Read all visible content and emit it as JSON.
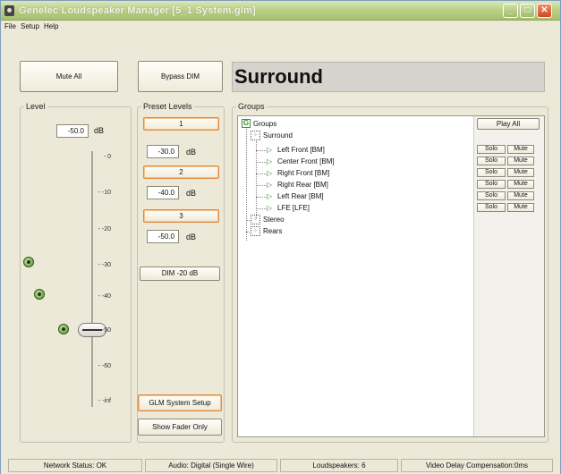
{
  "window": {
    "title": "Genelec Loudspeaker Manager [5_1 System.glm]",
    "buttons": [
      "minimize",
      "maximize",
      "close"
    ]
  },
  "menu": [
    "File",
    "Setup",
    "Help"
  ],
  "toolbar": {
    "mute_all": "Mute All",
    "bypass_dim": "Bypass DIM"
  },
  "header": {
    "title": "Surround"
  },
  "level": {
    "label": "Level",
    "value": "-50.0",
    "unit": "dB",
    "ticks": [
      "- 0",
      "- -10",
      "- -20",
      "- -30",
      "- -40",
      "- -50",
      "- -60",
      "- -inf"
    ],
    "fader_value_db": -50
  },
  "preset_levels": {
    "label": "Preset Levels",
    "presets": [
      {
        "button": "1",
        "value": "-30.0",
        "unit": "dB"
      },
      {
        "button": "2",
        "value": "-40.0",
        "unit": "dB"
      },
      {
        "button": "3",
        "value": "-50.0",
        "unit": "dB"
      }
    ],
    "dim": "DIM -20 dB"
  },
  "bottom_buttons": {
    "system_setup": "GLM System Setup",
    "fader_only": "Show Fader Only"
  },
  "groups": {
    "label": "Groups",
    "root": "Groups",
    "play_all": "Play All",
    "surround": "Surround",
    "speakers": [
      "Left Front [BM]",
      "Center Front [BM]",
      "Right Front [BM]",
      "Right Rear [BM]",
      "Left Rear [BM]",
      "LFE [LFE]"
    ],
    "other_groups": [
      "Stereo",
      "Rears"
    ],
    "solo": "Solo",
    "mute": "Mute"
  },
  "status": {
    "network": "Network Status: OK",
    "audio": "Audio: Digital (Single Wire)",
    "loudspeakers": "Loudspeakers: 6",
    "video_delay": "Video Delay Compensation:0ms"
  }
}
